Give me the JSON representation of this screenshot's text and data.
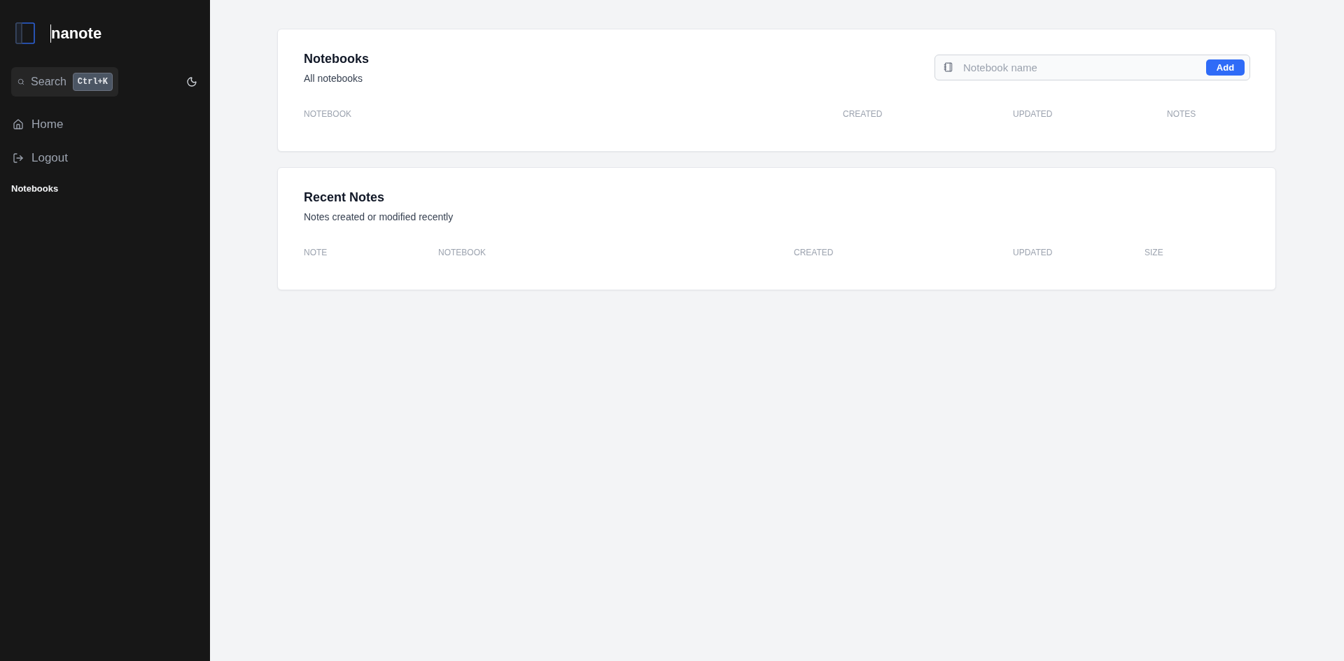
{
  "sidebar": {
    "logo": {
      "title": "nanote"
    },
    "search": {
      "label": "Search",
      "shortcut": "Ctrl+K"
    },
    "nav_items": [
      {
        "label": "Home",
        "kind": "home"
      },
      {
        "label": "Logout",
        "kind": "logout"
      }
    ],
    "section_title": "Notebooks"
  },
  "notebooks_card": {
    "title": "Notebooks",
    "subtitle": "All notebooks",
    "input": {
      "placeholder": "Notebook name"
    },
    "add_button": "Add",
    "columns": [
      "NOTEBOOK",
      "CREATED",
      "UPDATED",
      "NOTES"
    ]
  },
  "recent_notes_card": {
    "title": "Recent Notes",
    "subtitle": "Notes created or modified recently",
    "columns": [
      "NOTE",
      "NOTEBOOK",
      "CREATED",
      "UPDATED",
      "SIZE"
    ]
  }
}
